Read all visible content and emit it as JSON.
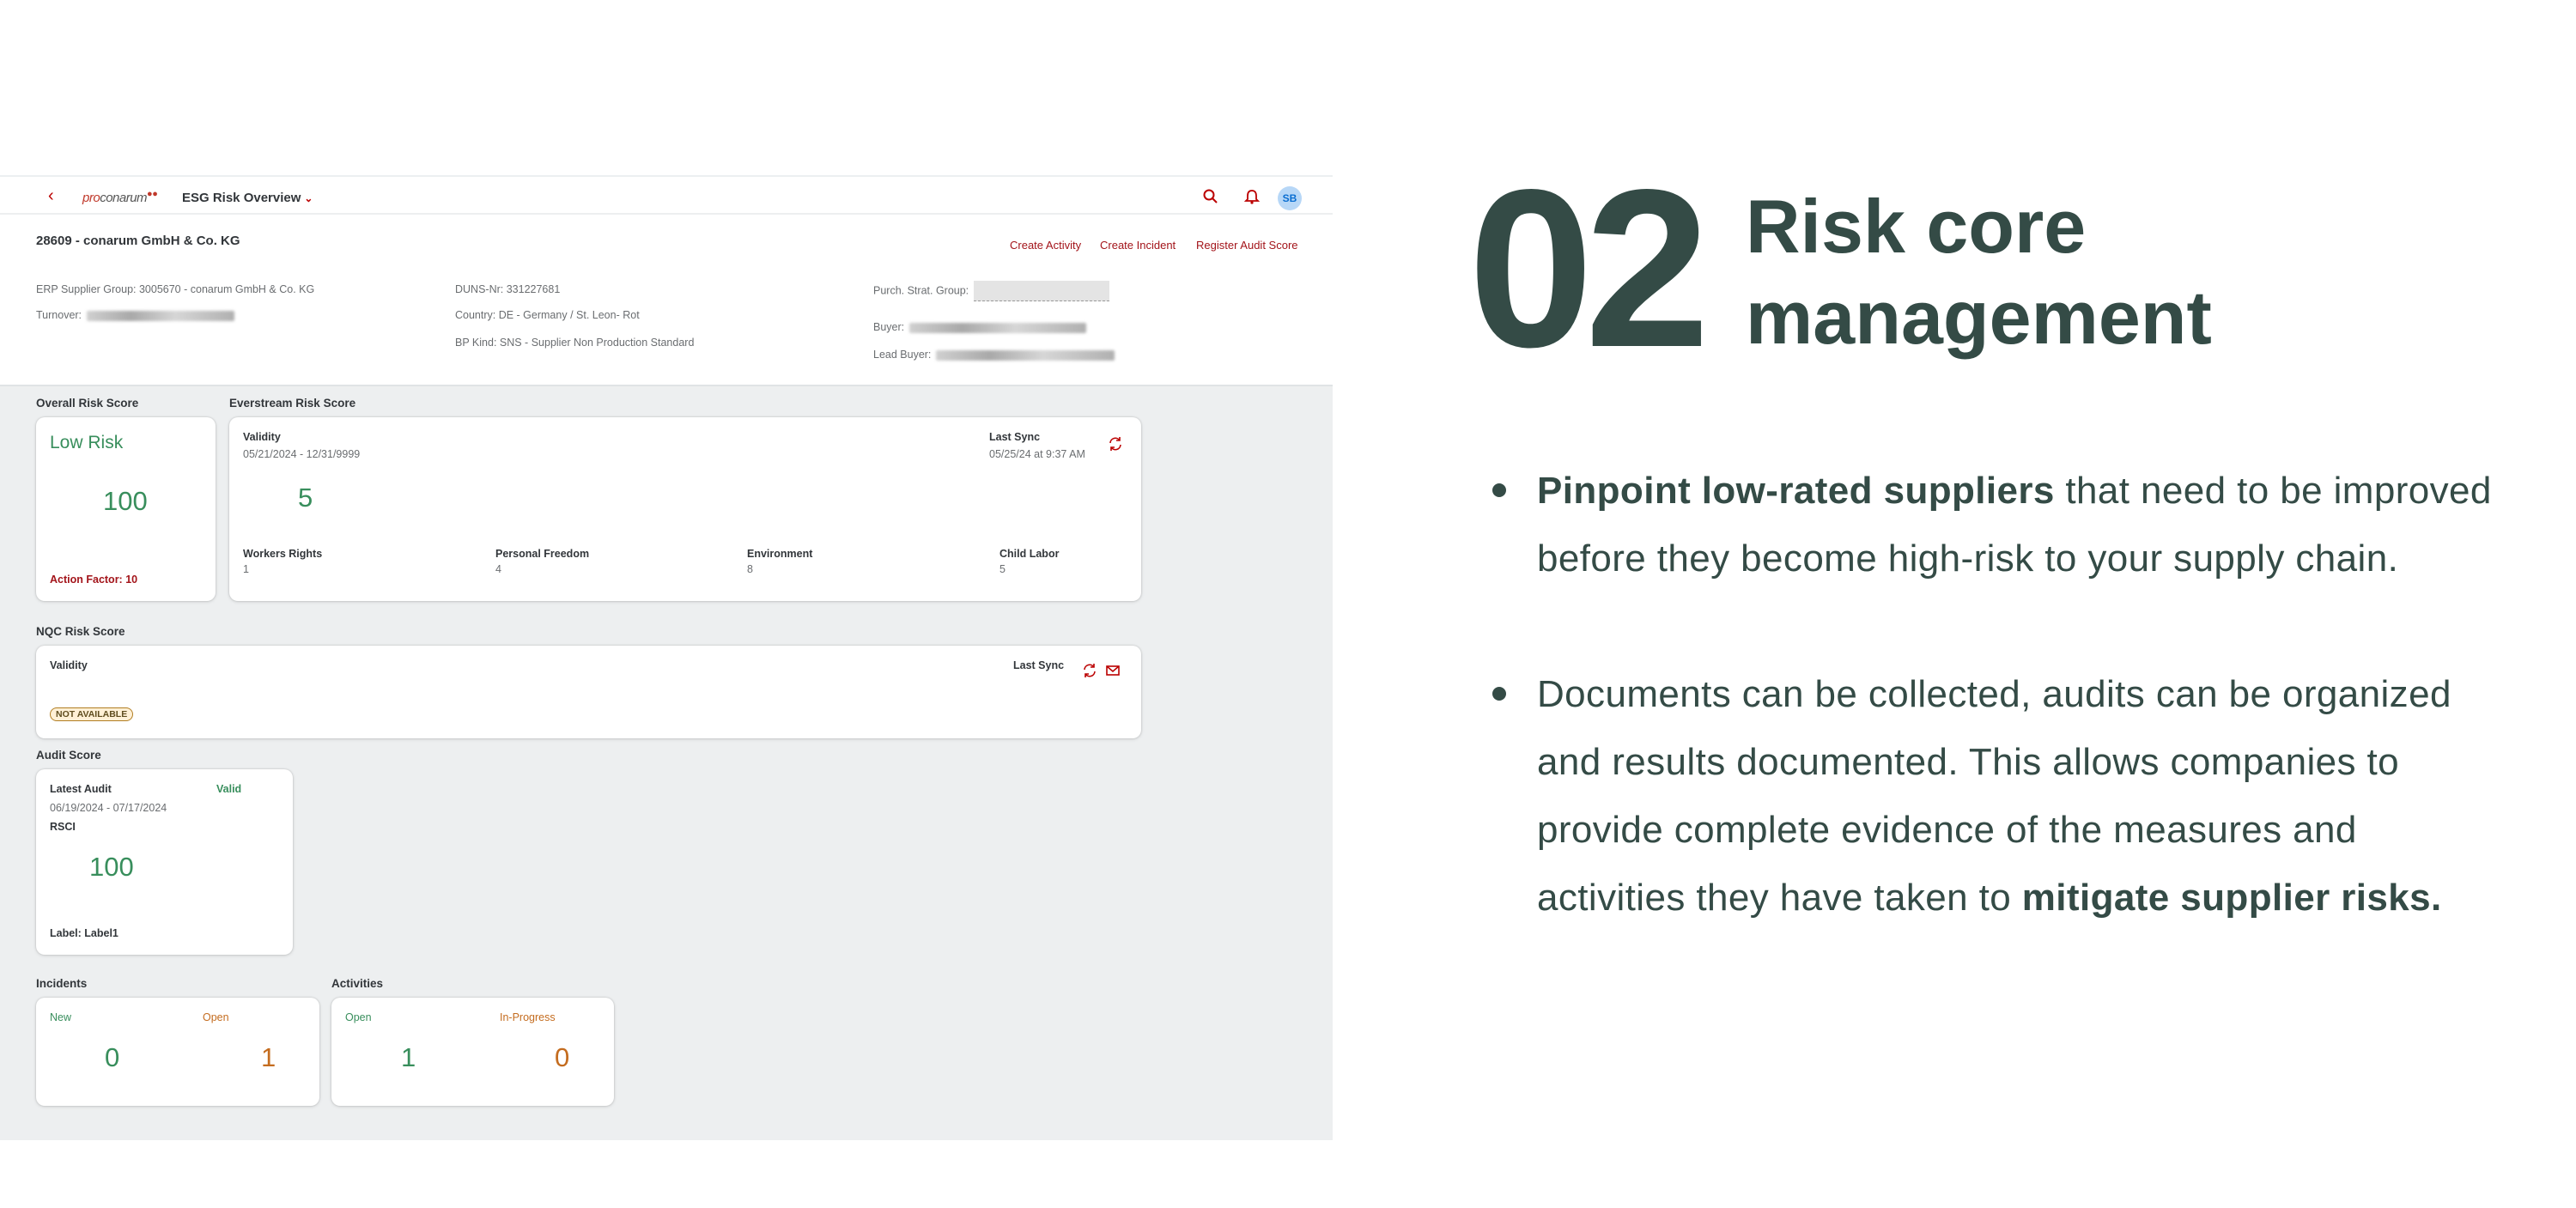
{
  "app": {
    "back_glyph": "‹",
    "logo_prefix": "pro",
    "logo_main": "conarum",
    "title": "ESG Risk Overview",
    "title_chevron": "⌄",
    "avatar": "SB",
    "icons": [
      "back-icon",
      "search-icon",
      "bell-icon",
      "refresh-icon",
      "email-icon"
    ],
    "accent": "#bb0000",
    "success": "#388e5c"
  },
  "header": {
    "title": "28609 - conarum GmbH & Co. KG",
    "actions": [
      "Create Activity",
      "Create Incident",
      "Register Audit Score"
    ],
    "erp_group": "ERP Supplier Group: 3005670 - conarum GmbH & Co. KG",
    "turnover_label": "Turnover:",
    "duns": "DUNS-Nr: 331227681",
    "country": "Country: DE - Germany / St. Leon- Rot",
    "bp_kind": "BP Kind: SNS - Supplier Non Production Standard",
    "purch_label": "Purch. Strat. Group:",
    "buyer_label": "Buyer:",
    "lead_buyer_label": "Lead Buyer:"
  },
  "overall": {
    "section": "Overall Risk Score",
    "risk": "Low Risk",
    "score": "100",
    "action_factor": "Action Factor: 10"
  },
  "everstream": {
    "section": "Everstream Risk Score",
    "validity_label": "Validity",
    "validity": "05/21/2024 - 12/31/9999",
    "last_sync_label": "Last Sync",
    "last_sync": "05/25/24 at 9:37 AM",
    "score": "5",
    "metrics": [
      {
        "label": "Workers Rights",
        "value": "1"
      },
      {
        "label": "Personal Freedom",
        "value": "4"
      },
      {
        "label": "Environment",
        "value": "8"
      },
      {
        "label": "Child Labor",
        "value": "5"
      }
    ]
  },
  "nqc": {
    "section": "NQC Risk Score",
    "validity_label": "Validity",
    "last_sync_label": "Last Sync",
    "status": "NOT AVAILABLE"
  },
  "audit": {
    "section": "Audit Score",
    "latest_label": "Latest Audit",
    "status": "Valid",
    "period": "06/19/2024 - 07/17/2024",
    "type": "RSCI",
    "score": "100",
    "label": "Label: Label1"
  },
  "incidents": {
    "section": "Incidents",
    "new_label": "New",
    "open_label": "Open",
    "new_count": "0",
    "open_count": "1"
  },
  "activities": {
    "section": "Activities",
    "open_label": "Open",
    "progress_label": "In-Progress",
    "open_count": "1",
    "progress_count": "0"
  },
  "marketing": {
    "number": "02",
    "headline_line1": "Risk core",
    "headline_line2": "management",
    "b1_l1_bold": "Pinpoint low-rated suppliers",
    "b1_l1_rest": " that need to be improved",
    "b1_l2": "before they become high-risk to your supply chain.",
    "b2_l1": "Documents can be collected, audits can be organized",
    "b2_l2": "and results documented. This allows companies to",
    "b2_l3": "provide complete evidence of the measures and",
    "b2_l4": "activities they have taken to ",
    "b2_l4_bold": "mitigate supplier risks."
  }
}
